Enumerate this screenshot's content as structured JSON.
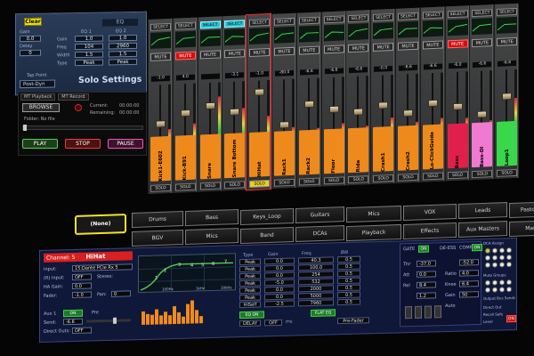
{
  "solo_settings": {
    "clear_label": "Clear",
    "eq_label": "EQ",
    "eq1_header": "EQ 1",
    "eq2_header": "EQ 2",
    "gain_label": "Gain",
    "freq_label": "Freq",
    "delay_label": "Delay",
    "width_label": "Width",
    "type_label": "Type",
    "gain_value": "0.0",
    "delay_value": "0",
    "eq1": {
      "gain": "1.0",
      "freq": "104",
      "width": "1.5",
      "type": "Peak"
    },
    "eq2": {
      "gain": "1.0",
      "freq": "2960",
      "width": "1.5",
      "type": "Peak"
    },
    "tap_label": "Tap Point",
    "tap_value": "Post-Dyn",
    "title": "Solo Settings"
  },
  "playback": {
    "tab1": "MT Playback",
    "tab2": "MT Record",
    "browse": "BROWSE",
    "current_label": "Current:",
    "current_value": "00:00:00",
    "remaining_label": "Remaining:",
    "remaining_value": "00:00:00",
    "folder_text": "Folder: No file",
    "play": "PLAY",
    "stop": "STOP",
    "pause": "PAUSE"
  },
  "mixer": {
    "select_label": "SELECT",
    "mute_label": "MUTE",
    "solo_label": "SOLO",
    "channels": [
      {
        "name": "Kick1-E602",
        "volume": "-1.0",
        "color": "#ee8a1c",
        "muted": false,
        "selected": false,
        "meter": 0.38,
        "fader": 0.55
      },
      {
        "name": "Kick-B91",
        "volume": "4.0",
        "color": "#ee8a1c",
        "muted": true,
        "selected": false,
        "meter": 0.44,
        "fader": 0.4
      },
      {
        "name": "Snare",
        "volume": "",
        "color": "#ee8a1c",
        "muted": false,
        "selected": true,
        "meter": 0.8,
        "fader": 0.3
      },
      {
        "name": "Snare Bottom",
        "volume": "-3.1",
        "color": "#ee8a1c",
        "muted": false,
        "selected": true,
        "meter": 0.62,
        "fader": 0.42
      },
      {
        "name": "HiHat",
        "volume": "-1.0",
        "color": "#ee8a1c",
        "muted": false,
        "selected": false,
        "meter": 0.5,
        "fader": 0.12,
        "active": true
      },
      {
        "name": "Rack1",
        "volume": "-80.0",
        "color": "#ee8a1c",
        "muted": false,
        "selected": false,
        "meter": 0.33,
        "fader": 0.65
      },
      {
        "name": "Rack2",
        "volume": "-6.6",
        "color": "#ee8a1c",
        "muted": false,
        "selected": false,
        "meter": 0.3,
        "fader": 0.35
      },
      {
        "name": "Floor",
        "volume": "-6.6",
        "color": "#ee8a1c",
        "muted": false,
        "selected": false,
        "meter": 0.35,
        "fader": 0.45
      },
      {
        "name": "Ride",
        "volume": "-6.6",
        "color": "#ee8a1c",
        "muted": false,
        "selected": false,
        "meter": 0.3,
        "fader": 0.5
      },
      {
        "name": "Crash1",
        "volume": "-0.0",
        "color": "#ee8a1c",
        "muted": false,
        "selected": false,
        "meter": 0.4,
        "fader": 0.42
      },
      {
        "name": "Crash2",
        "volume": "-6.6",
        "color": "#ee8a1c",
        "muted": false,
        "selected": false,
        "meter": 0.32,
        "fader": 0.55
      },
      {
        "name": "Lo-ClickGuide",
        "volume": "-6.6",
        "color": "#ee8a1c",
        "muted": false,
        "selected": false,
        "meter": 0.36,
        "fader": 0.42
      },
      {
        "name": "Bass",
        "volume": "-6.0",
        "color": "#e0204a",
        "muted": true,
        "selected": false,
        "meter": 0.35,
        "fader": 0.48
      },
      {
        "name": "Bass-DI",
        "volume": "-6.6",
        "color": "#f07ad0",
        "muted": false,
        "selected": false,
        "meter": 0.3,
        "fader": 0.62
      },
      {
        "name": "Loop1",
        "volume": "-6.6",
        "color": "#38d84a",
        "muted": false,
        "selected": false,
        "meter": 0.6,
        "fader": 0.36
      }
    ]
  },
  "groups": {
    "none_label": "(None)",
    "row1": [
      "Drums",
      "Bass",
      "Keys_Loop",
      "Guitars",
      "Mics",
      "VOX",
      "Leads",
      "Pastor Host"
    ],
    "row2": [
      "BGV",
      "Mics",
      "Band",
      "DCAs",
      "Playback",
      "Effects",
      "Aux Masters",
      "Masters"
    ]
  },
  "channel_panel": {
    "channel_label": "Channel: 5",
    "channel_name": "HiHat",
    "input_label": "Input:",
    "input_value": "15:Dante PCIe Rx 5",
    "r_input_label": "(R) Input:",
    "r_input_value": "OFF",
    "stereo_label": "Stereo:",
    "ha_gain_label": "HA Gain:",
    "ha_gain_value": "0.0",
    "fader_label": "Fader:",
    "fader_value": "-1.0",
    "pan_label": "Pan:",
    "pan_value": "0",
    "aux1_label": "Aux 1",
    "aux1_value": "ON",
    "send_label": "Send:",
    "send_value": "-6.6",
    "direct_out_label": "Direct Outs:",
    "direct_out_value": "OFF",
    "pre_label": "Pre",
    "eq_curve_points": [
      "1",
      "2",
      "3",
      "4",
      "5",
      "6",
      "7"
    ],
    "freq_axis": [
      "100Hz",
      "1kHz",
      "10kHz"
    ],
    "meter_bars": [
      0.55,
      0.42,
      0.38,
      0.6,
      0.34,
      0.5,
      0.36,
      0.7,
      0.45,
      0.3,
      0.8,
      0.92,
      0.55,
      0.3
    ],
    "eq_table": {
      "headers": [
        "Type",
        "Gain",
        "Freq",
        "BW"
      ],
      "rows": [
        [
          "Peak",
          "0.0",
          "40.3",
          "0.5"
        ],
        [
          "Peak",
          "0.0",
          "100.0",
          "0.5"
        ],
        [
          "Peak",
          "0.0",
          "254",
          "0.5"
        ],
        [
          "Peak",
          "-5.0",
          "532",
          "0.5"
        ],
        [
          "Peak",
          "0.0",
          "2000",
          "0.5"
        ],
        [
          "Peak",
          "0.0",
          "5000",
          "0.5"
        ],
        [
          "HiSelf",
          "-2.5",
          "7960",
          "0.5"
        ]
      ],
      "eq_on": "EQ ON",
      "flat_eq": "FLAT EQ",
      "delay_label": "DELAY",
      "delay_value": "OFF",
      "ms_label": "ms",
      "pre_fader_label": "Pre-Fader"
    },
    "dynamics": {
      "gate_label": "GATE",
      "gate_value": "ON",
      "de_esser_label": "DE-ESS",
      "comp_label": "COMP",
      "comp_value": "ON",
      "thr_label": "Thr",
      "att_label": "Att",
      "rel_label": "Rel",
      "ratio_label": "Ratio",
      "knee_label": "Knee",
      "values": [
        "-37.0",
        "0.0",
        "8.4",
        "1.2",
        "-52.0",
        "4.0",
        "6.4",
        "50"
      ],
      "gain_label": "Gain",
      "auto_label": "Auto"
    },
    "dca": {
      "header1": "DCA Assign",
      "header2": "Mute Groups",
      "output_label": "Output Bus Sends",
      "direct_out_label": "Direct Out",
      "recall_safe_label": "Recall Safe",
      "level_label": "Level",
      "on_label": "ON"
    }
  }
}
